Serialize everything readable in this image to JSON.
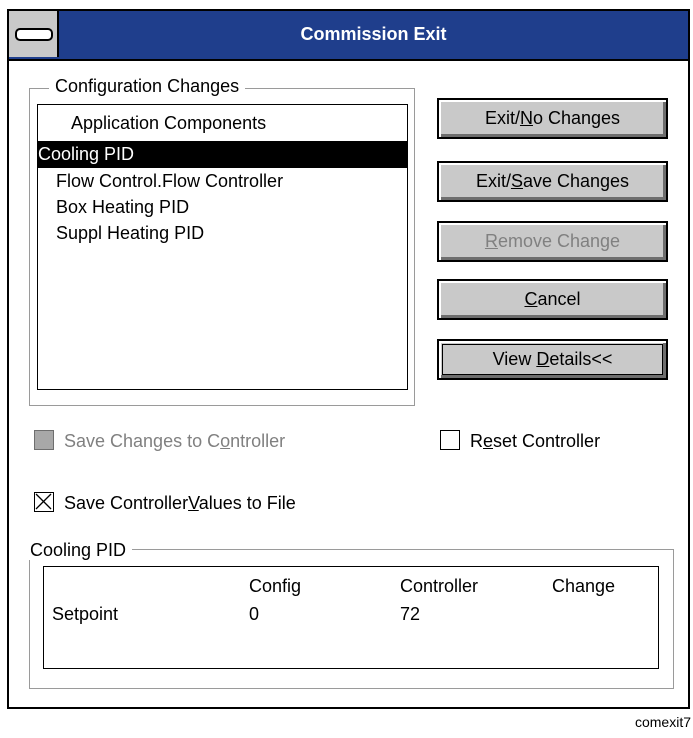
{
  "window": {
    "title": "Commission Exit",
    "system_menu_icon": "system-menu-dash-icon"
  },
  "config_group": {
    "label": "Configuration Changes",
    "list_header": "Application Components",
    "items": [
      {
        "label": "Cooling PID",
        "selected": true
      },
      {
        "label": "Flow Control.Flow Controller",
        "selected": false
      },
      {
        "label": "Box Heating PID",
        "selected": false
      },
      {
        "label": "Suppl Heating PID",
        "selected": false
      }
    ]
  },
  "buttons": {
    "exit_no_changes": {
      "pre": "Exit/",
      "ul": "N",
      "post": "o Changes"
    },
    "exit_save_changes": {
      "pre": "Exit/",
      "ul": "S",
      "post": "ave Changes"
    },
    "remove_change": {
      "pre": "",
      "ul": "R",
      "post": "emove Change",
      "disabled": true
    },
    "cancel": {
      "pre": "",
      "ul": "C",
      "post": "ancel"
    },
    "view_details": {
      "pre": "View ",
      "ul": "D",
      "post": "etails<<"
    }
  },
  "checkboxes": {
    "save_to_controller": {
      "pre": "Save Changes to C",
      "ul": "o",
      "post": "ntroller",
      "checked": false,
      "disabled": true
    },
    "reset_controller": {
      "pre": "R",
      "ul": "e",
      "post": "set Controller",
      "checked": false
    },
    "save_values_to_file": {
      "pre": "Save Controller",
      "ul": "V",
      "post": "alues to File",
      "checked": true
    }
  },
  "details_group": {
    "label": "Cooling PID",
    "columns": [
      "Config",
      "Controller",
      "Change"
    ],
    "rows": [
      {
        "name": "Setpoint",
        "config": "0",
        "controller": "72",
        "change": ""
      }
    ]
  },
  "caption": "comexit7"
}
